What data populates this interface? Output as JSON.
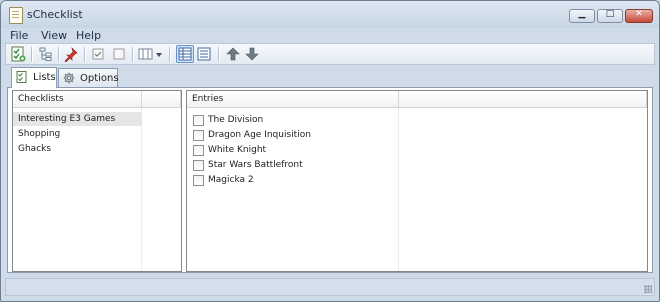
{
  "window": {
    "title": "sChecklist"
  },
  "window_controls": {
    "minimize": "▁",
    "maximize": "□",
    "close": "✕"
  },
  "menu": [
    "File",
    "View",
    "Help"
  ],
  "toolbar": {
    "icons": [
      "add-list-icon",
      "tree-icon",
      "pin-icon",
      "check-all-icon",
      "uncheck-all-icon",
      "columns-dropdown-icon",
      "details-view-icon",
      "list-view-icon",
      "move-up-icon",
      "move-down-icon"
    ]
  },
  "tabs": [
    {
      "label": "Lists",
      "icon": "lists-icon",
      "active": true
    },
    {
      "label": "Options",
      "icon": "gear-icon",
      "active": false
    }
  ],
  "checklists": {
    "header": "Checklists",
    "items": [
      "Interesting E3 Games",
      "Shopping",
      "Ghacks"
    ],
    "selected_index": 0
  },
  "entries": {
    "header": "Entries",
    "items": [
      {
        "label": "The Division",
        "checked": false
      },
      {
        "label": "Dragon Age Inquisition",
        "checked": false
      },
      {
        "label": "White Knight",
        "checked": false
      },
      {
        "label": "Star Wars Battlefront",
        "checked": false
      },
      {
        "label": "Magicka 2",
        "checked": false
      }
    ]
  },
  "colors": {
    "window_bg": "#cfdbe8",
    "accent": "#6b93c7",
    "selected_row": "#e5e5e5"
  }
}
